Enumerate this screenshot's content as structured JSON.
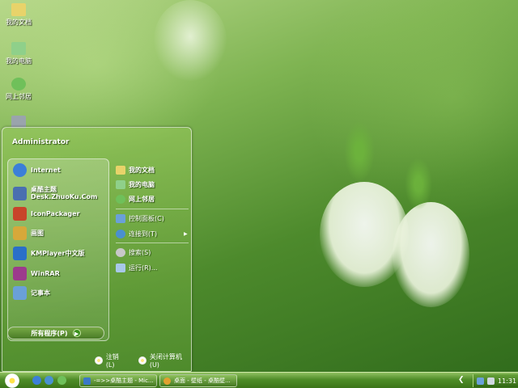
{
  "desktop": {
    "icons": [
      {
        "label": "我的文档",
        "icon": "folder-icon",
        "color": "#e8d36a"
      },
      {
        "label": "我的电脑",
        "icon": "computer-icon",
        "color": "#8fd08a"
      },
      {
        "label": "网上邻居",
        "icon": "network-icon",
        "color": "#6fc05a"
      },
      {
        "label": "",
        "icon": "recycle-bin-icon",
        "color": "#9aa4ac"
      }
    ]
  },
  "start_menu": {
    "user_name": "Administrator",
    "pinned": [
      {
        "label": "Internet",
        "icon": "internet-explorer-icon",
        "color": "#3c7fd8"
      },
      {
        "label": "桌酷主题\nDesk.ZhuoKu.Com",
        "icon": "zhuoku-theme-icon",
        "color": "#4a6fb0"
      }
    ],
    "programs": [
      {
        "label": "IconPackager",
        "icon": "iconpackager-icon",
        "color": "#c8442a"
      },
      {
        "label": "画图",
        "icon": "paint-icon",
        "color": "#d7a83a"
      },
      {
        "label": "KMPlayer中文版",
        "icon": "kmplayer-icon",
        "color": "#2a6fc8"
      },
      {
        "label": "WinRAR",
        "icon": "winrar-icon",
        "color": "#9c3b8c"
      },
      {
        "label": "记事本",
        "icon": "notepad-icon",
        "color": "#6aa0d8"
      }
    ],
    "all_programs_label": "所有程序(P)",
    "right_items": [
      {
        "label": "我的文档",
        "icon": "folder-icon",
        "color": "#e8d36a",
        "bold": true
      },
      {
        "label": "我的电脑",
        "icon": "computer-icon",
        "color": "#8fd08a",
        "bold": true
      },
      {
        "label": "网上邻居",
        "icon": "network-icon",
        "color": "#6fc05a",
        "bold": true
      },
      {
        "label": "控制面板(C)",
        "icon": "control-panel-icon",
        "color": "#6aa0d8",
        "bold": false
      },
      {
        "label": "连接到(T)",
        "icon": "connect-icon",
        "color": "#4a90d0",
        "bold": false,
        "submenu": true
      },
      {
        "label": "搜索(S)",
        "icon": "search-icon",
        "color": "#c8c8c8",
        "bold": false
      },
      {
        "label": "运行(R)...",
        "icon": "run-icon",
        "color": "#a8c8e8",
        "bold": false
      }
    ],
    "logoff_label": "注销(L)",
    "shutdown_label": "关闭计算机(U)"
  },
  "taskbar": {
    "tasks": [
      {
        "label": "-=>>桌酷主题 - Mic...",
        "icon": "document-icon",
        "color": "#3a78c8"
      },
      {
        "label": "桌面 - 壁纸 - 桌酷壁...",
        "icon": "browser-icon",
        "color": "#e0a030"
      }
    ],
    "clock": "11:31"
  }
}
